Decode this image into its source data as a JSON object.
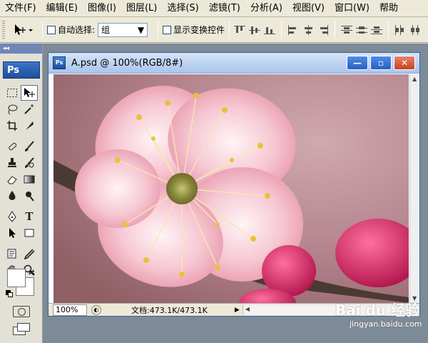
{
  "menu": [
    "文件(F)",
    "编辑(E)",
    "图像(I)",
    "图层(L)",
    "选择(S)",
    "滤镜(T)",
    "分析(A)",
    "视图(V)",
    "窗口(W)",
    "帮助"
  ],
  "options": {
    "auto_select_label": "自动选择:",
    "auto_select_value": "组",
    "show_transform_label": "显示变换控件"
  },
  "toolbox": {
    "logo": "Ps",
    "collapse_glyph": "◂◂",
    "fg_color": "#ffffff",
    "bg_color": "#ffffff"
  },
  "document": {
    "icon_text": "Ps",
    "title": "A.psd @ 100%(RGB/8#)",
    "zoom": "100%",
    "doc_info": "文档:473.1K/473.1K",
    "min_glyph": "—",
    "max_glyph": "▫",
    "close_glyph": "✕"
  },
  "watermark": {
    "logo": "Bai du 经验",
    "url": "jingyan.baidu.com"
  }
}
